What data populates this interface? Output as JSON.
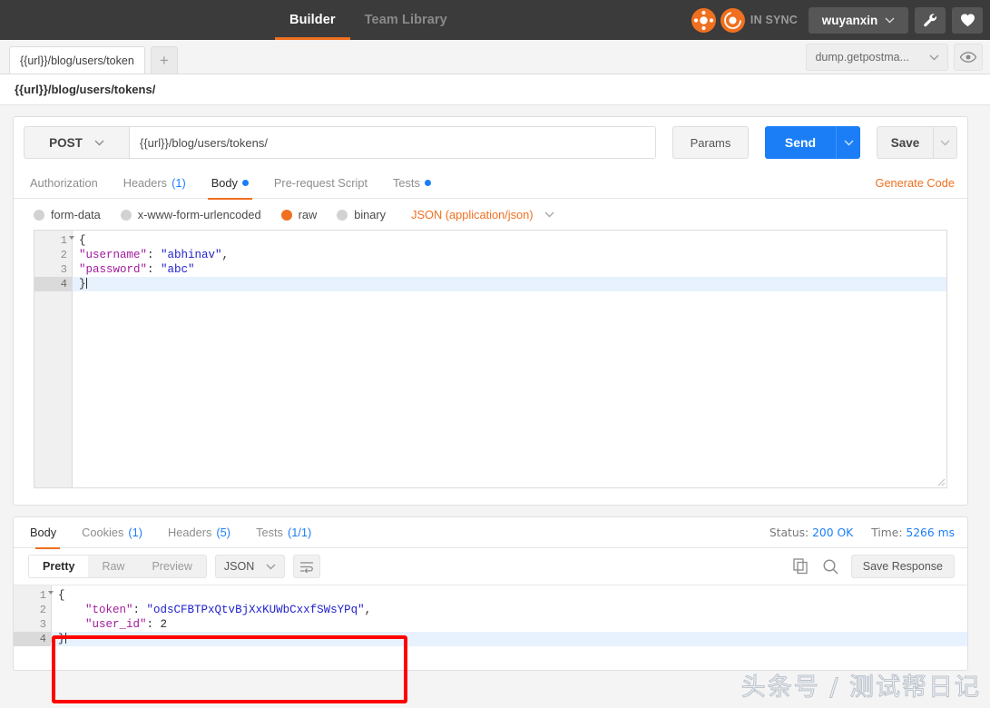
{
  "topbar": {
    "tabs": [
      {
        "label": "Builder",
        "active": true
      },
      {
        "label": "Team Library",
        "active": false
      }
    ],
    "sync_label": "IN SYNC",
    "user": "wuyanxin",
    "wrench_icon": "wrench-icon",
    "heart_icon": "heart-icon"
  },
  "tabstrip": {
    "request_tab_label": "{{url}}/blog/users/token",
    "add_tab_label": "+",
    "environment": "dump.getpostma...",
    "eye_icon": "eye-icon"
  },
  "request": {
    "title": "{{url}}/blog/users/tokens/",
    "method": "POST",
    "url": "{{url}}/blog/users/tokens/",
    "params_label": "Params",
    "send_label": "Send",
    "save_label": "Save",
    "tabs": [
      {
        "label": "Authorization",
        "badge": "",
        "dot": false,
        "active": false
      },
      {
        "label": "Headers",
        "badge": "(1)",
        "dot": false,
        "active": false
      },
      {
        "label": "Body",
        "badge": "",
        "dot": true,
        "active": true
      },
      {
        "label": "Pre-request Script",
        "badge": "",
        "dot": false,
        "active": false
      },
      {
        "label": "Tests",
        "badge": "",
        "dot": true,
        "active": false
      }
    ],
    "generate_code_label": "Generate Code",
    "body_types": [
      {
        "label": "form-data",
        "selected": false
      },
      {
        "label": "x-www-form-urlencoded",
        "selected": false
      },
      {
        "label": "raw",
        "selected": true
      },
      {
        "label": "binary",
        "selected": false
      }
    ],
    "raw_format": "JSON (application/json)",
    "body_lines": [
      {
        "n": "1",
        "fold": true,
        "current": false,
        "tokens": [
          {
            "t": "{",
            "c": "p"
          }
        ]
      },
      {
        "n": "2",
        "fold": false,
        "current": false,
        "tokens": [
          {
            "t": "\"username\"",
            "c": "k"
          },
          {
            "t": ": ",
            "c": "p"
          },
          {
            "t": "\"abhinav\"",
            "c": "v"
          },
          {
            "t": ",",
            "c": "p"
          }
        ]
      },
      {
        "n": "3",
        "fold": false,
        "current": false,
        "tokens": [
          {
            "t": "\"password\"",
            "c": "k"
          },
          {
            "t": ": ",
            "c": "p"
          },
          {
            "t": "\"abc\"",
            "c": "v"
          }
        ]
      },
      {
        "n": "4",
        "fold": false,
        "current": true,
        "tokens": [
          {
            "t": "}",
            "c": "p"
          }
        ]
      }
    ]
  },
  "response": {
    "tabs": [
      {
        "label": "Body",
        "badge": "",
        "active": true
      },
      {
        "label": "Cookies",
        "badge": "(1)",
        "active": false
      },
      {
        "label": "Headers",
        "badge": "(5)",
        "active": false
      },
      {
        "label": "Tests",
        "badge": "(1/1)",
        "active": false
      }
    ],
    "status_label": "Status:",
    "status_value": "200 OK",
    "time_label": "Time:",
    "time_value": "5266 ms",
    "view_modes": [
      {
        "label": "Pretty",
        "active": true
      },
      {
        "label": "Raw",
        "active": false
      },
      {
        "label": "Preview",
        "active": false
      }
    ],
    "format": "JSON",
    "wrap_icon": "word-wrap-icon",
    "copy_icon": "copy-icon",
    "search_icon": "search-icon",
    "save_response_label": "Save Response",
    "body_lines": [
      {
        "n": "1",
        "fold": true,
        "current": false,
        "tokens": [
          {
            "t": "{",
            "c": "p"
          }
        ]
      },
      {
        "n": "2",
        "fold": false,
        "current": false,
        "tokens": [
          {
            "t": "    ",
            "c": "p"
          },
          {
            "t": "\"token\"",
            "c": "k"
          },
          {
            "t": ": ",
            "c": "p"
          },
          {
            "t": "\"odsCFBTPxQtvBjXxKUWbCxxfSWsYPq\"",
            "c": "v"
          },
          {
            "t": ",",
            "c": "p"
          }
        ]
      },
      {
        "n": "3",
        "fold": false,
        "current": false,
        "tokens": [
          {
            "t": "    ",
            "c": "p"
          },
          {
            "t": "\"user_id\"",
            "c": "k"
          },
          {
            "t": ": ",
            "c": "p"
          },
          {
            "t": "2",
            "c": "num"
          }
        ]
      },
      {
        "n": "4",
        "fold": false,
        "current": true,
        "tokens": [
          {
            "t": "}",
            "c": "p"
          }
        ]
      }
    ]
  },
  "annotation": {
    "highlight_color": "#ff0000"
  },
  "watermark": {
    "text": "头条号 / 测试帮日记"
  },
  "colors": {
    "accent_orange": "#ef7020",
    "accent_blue": "#1b7ef7",
    "topbar_bg": "#3b3b3b"
  }
}
